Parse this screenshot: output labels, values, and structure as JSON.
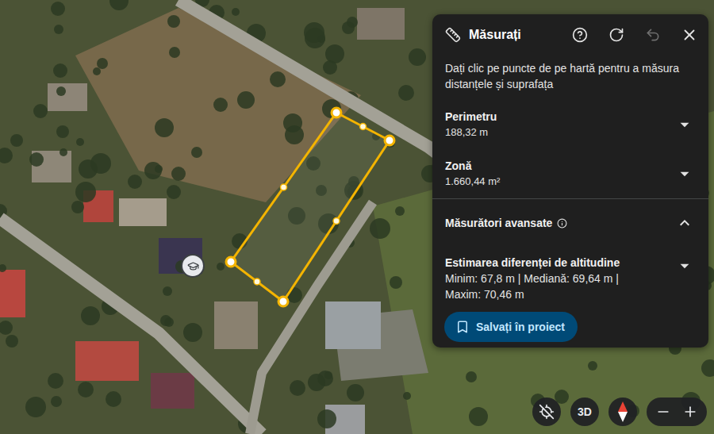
{
  "panel": {
    "title": "Măsurați",
    "undo_disabled": true,
    "description": "Dați clic pe puncte de pe hartă pentru a măsura distanțele și suprafața",
    "sections": [
      {
        "label": "Perimetru",
        "value": "188,32 m",
        "expanded": false
      },
      {
        "label": "Zonă",
        "value": "1.660,44 m²",
        "expanded": false
      }
    ],
    "advanced": {
      "label": "Măsurători avansate",
      "expanded": true,
      "items": [
        {
          "label": "Estimarea diferenței de altitudine",
          "value": "Minim: 67,8 m | Mediană: 69,64 m | Maxim: 70,46 m",
          "expanded": false
        }
      ]
    },
    "save_button": "Salvați în proiect"
  },
  "map_controls": {
    "view_mode": "3D"
  }
}
